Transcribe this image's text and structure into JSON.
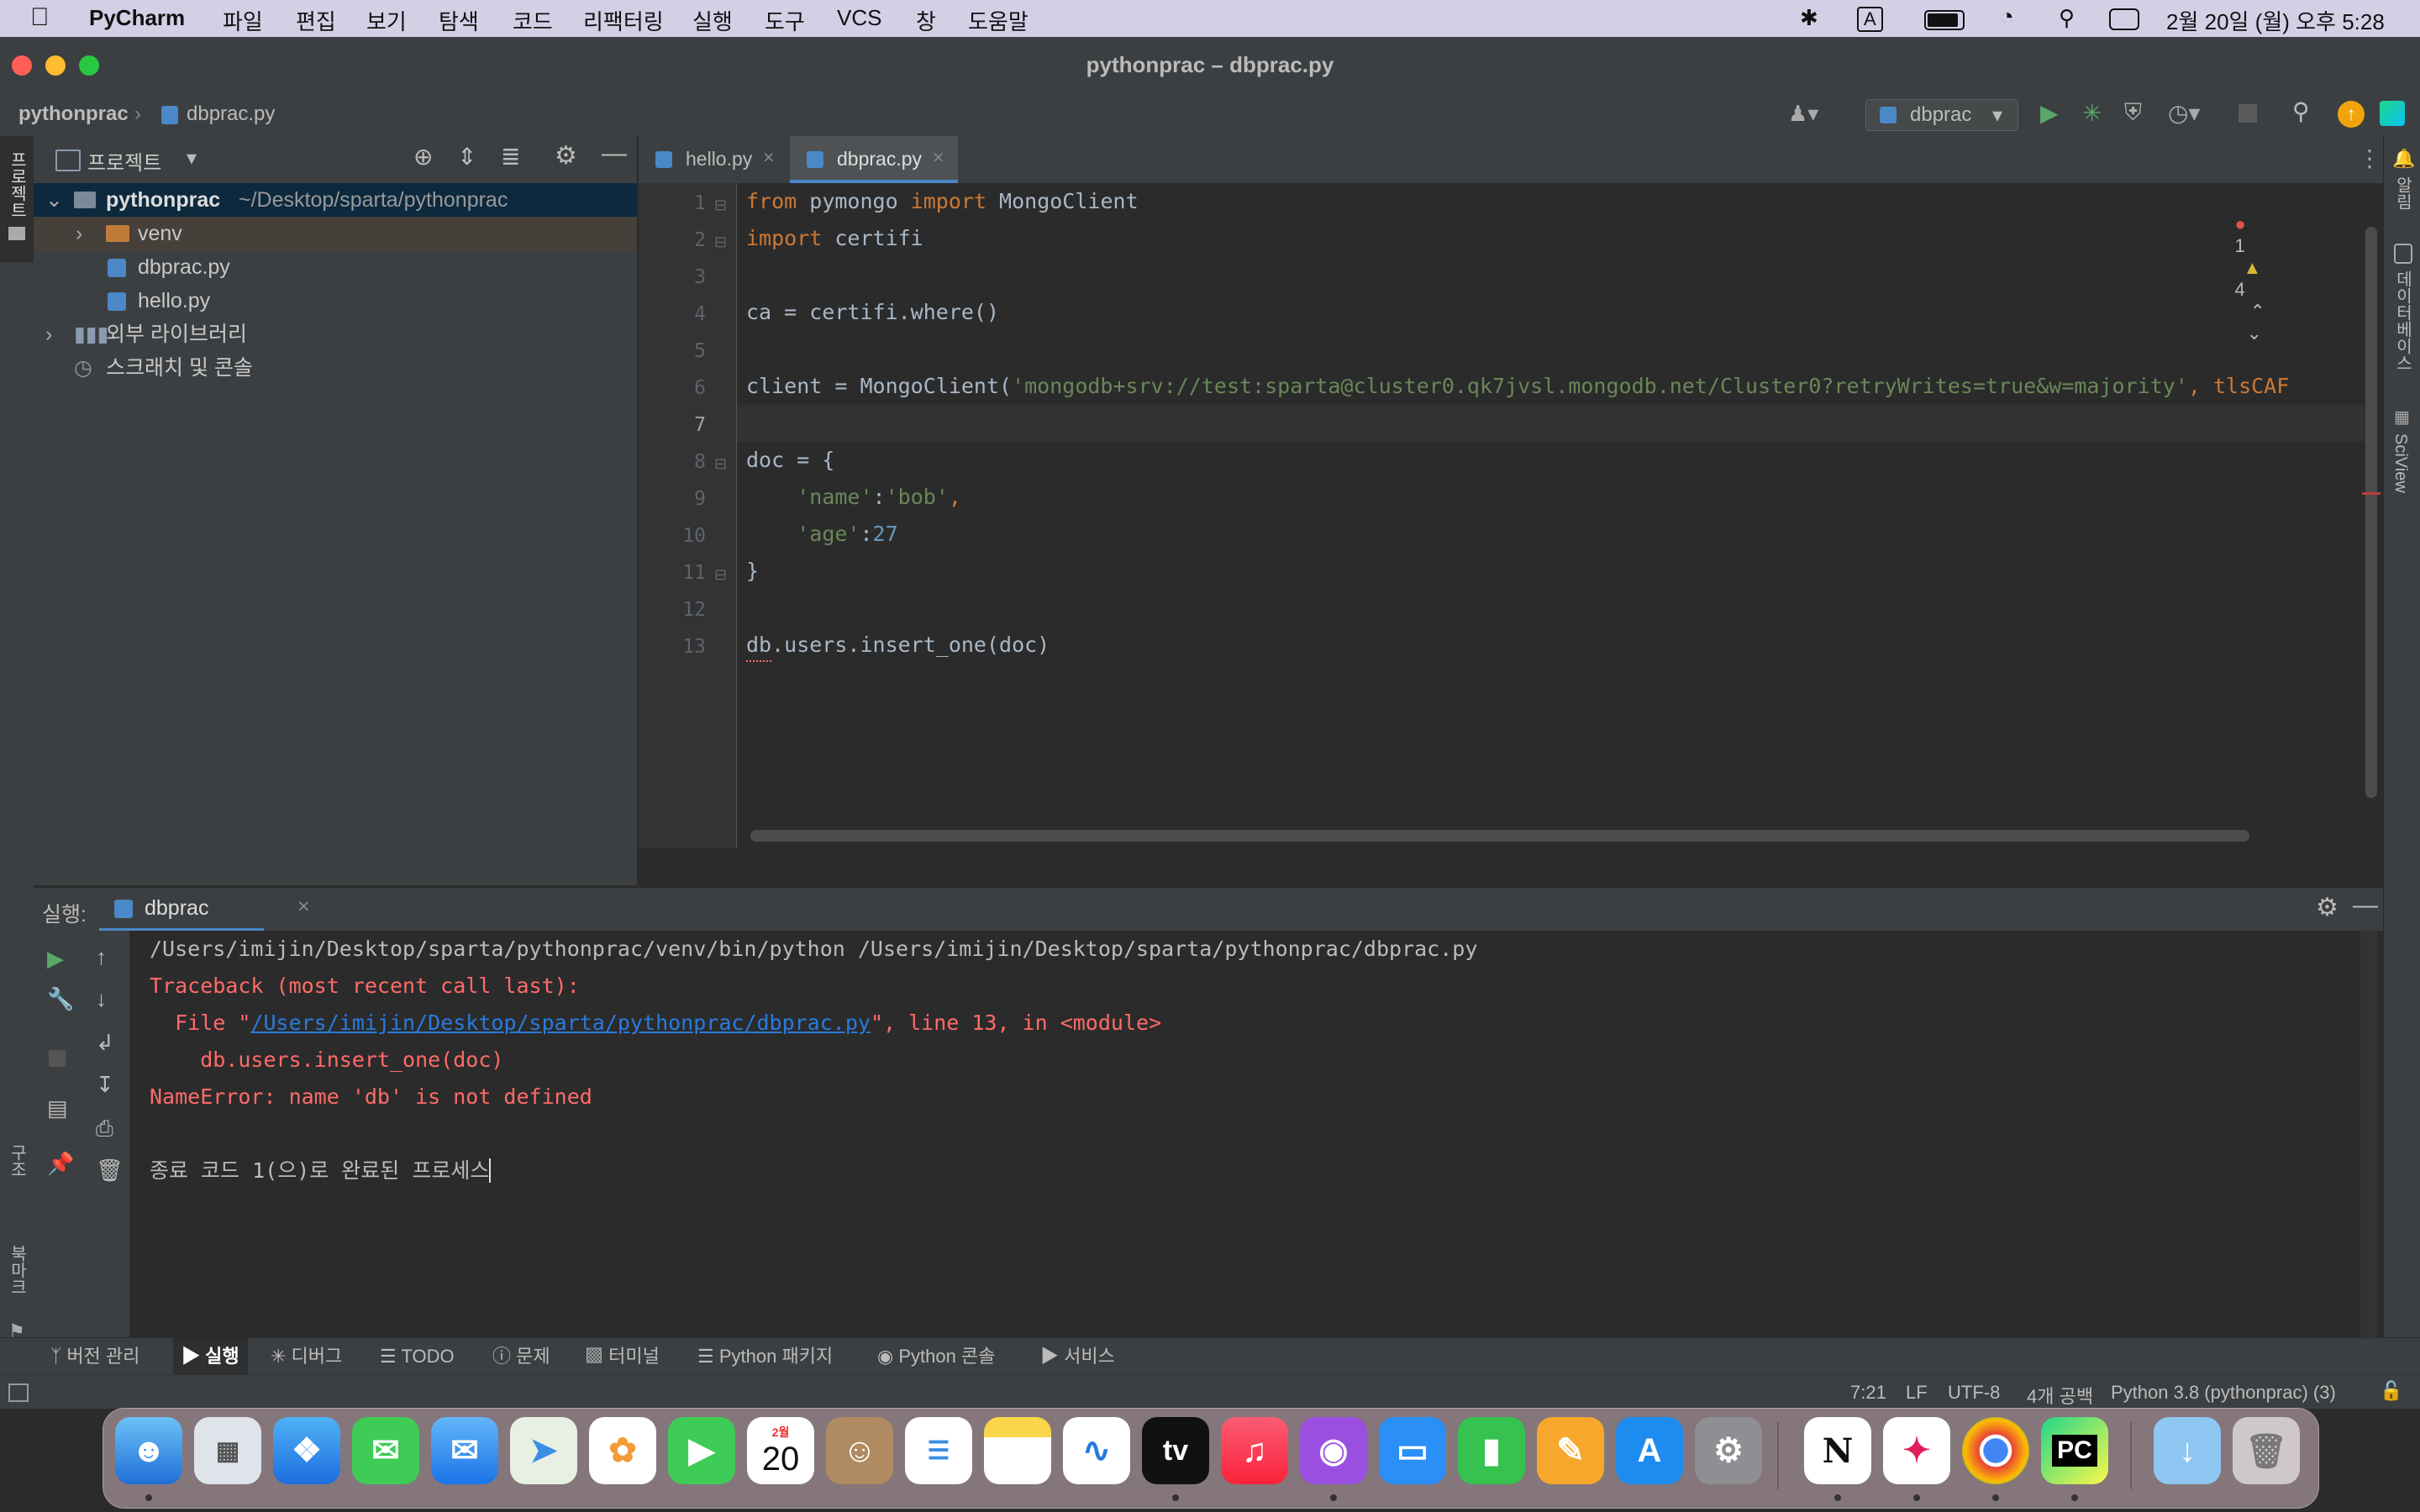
{
  "menubar": {
    "app": "PyCharm",
    "items": [
      "파일",
      "편집",
      "보기",
      "탐색",
      "코드",
      "리팩터링",
      "실행",
      "도구",
      "VCS",
      "창",
      "도움말"
    ],
    "input_indicator": "A",
    "datetime": "2월 20일 (월) 오후 5:28"
  },
  "window": {
    "title": "pythonprac – dbprac.py"
  },
  "navbar": {
    "project": "pythonprac",
    "file": "dbprac.py",
    "run_config": "dbprac"
  },
  "project_panel": {
    "title": "프로젝트",
    "root": {
      "name": "pythonprac",
      "path": "~/Desktop/sparta/pythonprac"
    },
    "items": [
      {
        "label": "venv"
      },
      {
        "label": "dbprac.py"
      },
      {
        "label": "hello.py"
      },
      {
        "label": "외부 라이브러리"
      },
      {
        "label": "스크래치 및 콘솔"
      }
    ]
  },
  "left_strip": {
    "project_label": "프로젝트",
    "structure_label": "구조",
    "bookmarks_label": "북마크"
  },
  "right_strip": {
    "notifications_label": "알림",
    "database_label": "데이터베이스",
    "sciview_label": "SciView"
  },
  "editor": {
    "tabs": [
      {
        "label": "hello.py"
      },
      {
        "label": "dbprac.py"
      }
    ],
    "inspections": {
      "errors": "1",
      "warnings": "4"
    },
    "line_numbers": [
      "1",
      "2",
      "3",
      "4",
      "5",
      "6",
      "7",
      "8",
      "9",
      "10",
      "11",
      "12",
      "13"
    ],
    "code": {
      "l1_kw1": "from",
      "l1_mod": " pymongo ",
      "l1_kw2": "import",
      "l1_rest": " MongoClient",
      "l2_kw": "import",
      "l2_rest": " certifi",
      "l4": "ca = certifi.where()",
      "l6_start": "client = MongoClient(",
      "l6_str": "'mongodb+srv://test:sparta@cluster0.qk7jvsl.mongodb.net/Cluster0?retryWrites=true&w=majority'",
      "l6_end": ", tlsCAF",
      "l8": "doc = {",
      "l9_key": "'name'",
      "l9_colon": ":",
      "l9_val": "'bob'",
      "l9_comma": ",",
      "l10_key": "'age'",
      "l10_colon": ":",
      "l10_val": "27",
      "l11": "}",
      "l13": "db.users.insert_one(doc)"
    }
  },
  "run_panel": {
    "label": "실행:",
    "tab": "dbprac",
    "output": {
      "cmd": "/Users/imijin/Desktop/sparta/pythonprac/venv/bin/python /Users/imijin/Desktop/sparta/pythonprac/dbprac.py",
      "tb1": "Traceback (most recent call last):",
      "tb2_pre": "  File \"",
      "tb2_link": "/Users/imijin/Desktop/sparta/pythonprac/dbprac.py",
      "tb2_post": "\", line 13, in <module>",
      "tb3": "    db.users.insert_one(doc)",
      "tb4": "NameError: name 'db' is not defined",
      "exit": "종료 코드 1(으)로 완료된 프로세스"
    }
  },
  "tool_tabs": [
    "버전 관리",
    "실행",
    "디버그",
    "TODO",
    "문제",
    "터미널",
    "Python 패키지",
    "Python 콘솔",
    "서비스"
  ],
  "statusbar": {
    "position": "7:21",
    "line_sep": "LF",
    "encoding": "UTF-8",
    "indent": "4개 공백",
    "interpreter": "Python 3.8 (pythonprac) (3)"
  },
  "dock": {
    "calendar_month": "2월",
    "calendar_day": "20",
    "appletv": "tv",
    "pycharm": "PC",
    "notion": "N"
  },
  "colors": {
    "accent": "#4a88c7",
    "error": "#ff6b68",
    "keyword": "#cc7832",
    "string": "#6a8759",
    "number": "#6897bb"
  }
}
